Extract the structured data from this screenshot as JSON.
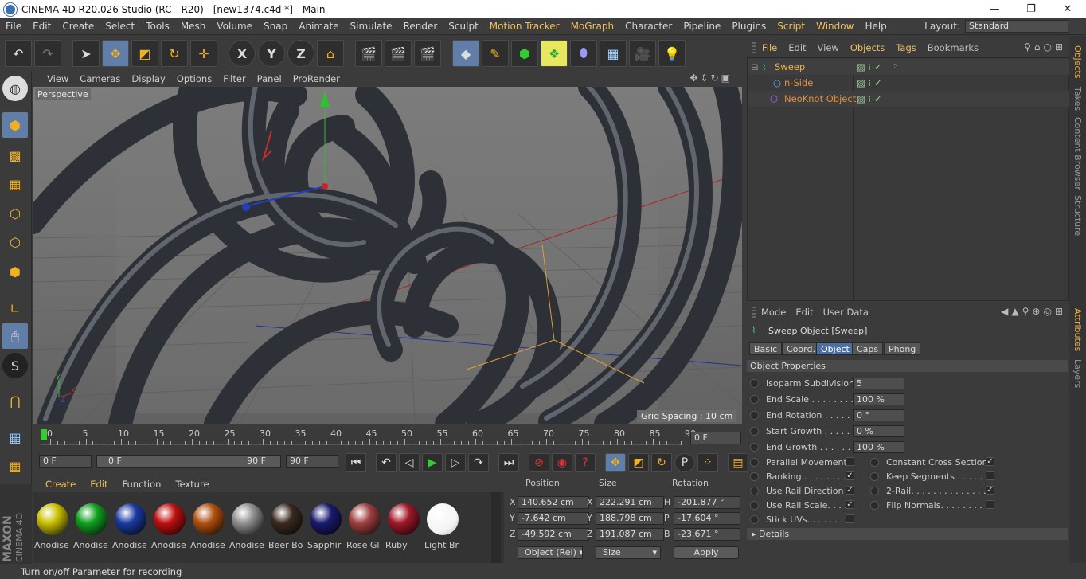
{
  "title": "CINEMA 4D R20.026 Studio (RC - R20) - [new1374.c4d *] - Main",
  "window_controls": {
    "minimize": "—",
    "maximize": "❐",
    "close": "✕"
  },
  "menu": [
    "File",
    "Edit",
    "Create",
    "Select",
    "Tools",
    "Mesh",
    "Volume",
    "Snap",
    "Animate",
    "Simulate",
    "Render",
    "Sculpt",
    "Motion Tracker",
    "MoGraph",
    "Character",
    "Pipeline",
    "Plugins",
    "Script",
    "Window",
    "Help"
  ],
  "layout": {
    "label": "Layout:",
    "value": "Standard"
  },
  "viewport": {
    "menu": [
      "View",
      "Cameras",
      "Display",
      "Options",
      "Filter",
      "Panel",
      "ProRender"
    ],
    "camera_label": "Perspective",
    "grid_spacing": "Grid Spacing : 10 cm"
  },
  "timeline": {
    "ticks": [
      "0",
      "5",
      "10",
      "15",
      "20",
      "25",
      "30",
      "35",
      "40",
      "45",
      "50",
      "55",
      "60",
      "65",
      "70",
      "75",
      "80",
      "85",
      "90"
    ],
    "current_frame": "0 F",
    "start": "0 F",
    "range_start": "0 F",
    "range_end": "90 F",
    "end": "90 F"
  },
  "materials": {
    "menu": [
      "Create",
      "Edit",
      "Function",
      "Texture"
    ],
    "items": [
      {
        "label": "Anodise",
        "color": "#c8c000"
      },
      {
        "label": "Anodise",
        "color": "#10a020"
      },
      {
        "label": "Anodise",
        "color": "#1a3aa0"
      },
      {
        "label": "Anodise",
        "color": "#c01010"
      },
      {
        "label": "Anodise",
        "color": "#b05010"
      },
      {
        "label": "Anodise",
        "color": "#909090"
      },
      {
        "label": "Beer Bo",
        "color": "#3a2a20"
      },
      {
        "label": "Sapphir",
        "color": "#1a1a70"
      },
      {
        "label": "Rose Gl",
        "color": "#a04040"
      },
      {
        "label": "Ruby",
        "color": "#a01828"
      },
      {
        "label": "Light Br",
        "color": "#f4f4f4"
      }
    ]
  },
  "coordinates": {
    "headers": {
      "position": "Position",
      "size": "Size",
      "rotation": "Rotation"
    },
    "rows": [
      {
        "axis": "X",
        "pos": "140.652 cm",
        "size_axis": "X",
        "size": "222.291 cm",
        "rot_axis": "H",
        "rot": "-201.877 °"
      },
      {
        "axis": "Y",
        "pos": "-7.642 cm",
        "size_axis": "Y",
        "size": "188.798 cm",
        "rot_axis": "P",
        "rot": "-17.604 °"
      },
      {
        "axis": "Z",
        "pos": "-49.592 cm",
        "size_axis": "Z",
        "size": "191.087 cm",
        "rot_axis": "B",
        "rot": "-23.671 °"
      }
    ],
    "mode": "Object (Rel)",
    "size_mode": "Size",
    "apply": "Apply"
  },
  "status": "Turn on/off Parameter for recording",
  "object_manager": {
    "menu": [
      "File",
      "Edit",
      "View",
      "Objects",
      "Tags",
      "Bookmarks"
    ],
    "objects": [
      {
        "name": "Sweep",
        "indent": 0
      },
      {
        "name": "n-Side",
        "indent": 1
      },
      {
        "name": "NeoKnot Object",
        "indent": 1
      }
    ],
    "side_tabs": [
      "Objects",
      "Takes",
      "Content Browser",
      "Structure"
    ]
  },
  "attributes": {
    "menu": [
      "Mode",
      "Edit",
      "User Data"
    ],
    "object_title": "Sweep Object [Sweep]",
    "tabs": [
      "Basic",
      "Coord.",
      "Object",
      "Caps",
      "Phong"
    ],
    "active_tab": "Object",
    "section": "Object Properties",
    "fields": [
      {
        "label": "Isoparm Subdivision",
        "value": "5"
      },
      {
        "label": "End Scale . . . . . . . . . .",
        "value": "100 %"
      },
      {
        "label": "End Rotation . . . . . . .",
        "value": "0 °"
      },
      {
        "label": "Start Growth . . . . . . .",
        "value": "0 %"
      },
      {
        "label": "End Growth . . . . . . . .",
        "value": "100 %"
      }
    ],
    "checks_left": [
      {
        "label": "Parallel Movement",
        "checked": false
      },
      {
        "label": "Banking . . . . . . . . .",
        "checked": true
      },
      {
        "label": "Use Rail Direction",
        "checked": true
      },
      {
        "label": "Use Rail Scale. . . .",
        "checked": true
      },
      {
        "label": "Stick UVs. . . . . . . .",
        "checked": false
      }
    ],
    "checks_right": [
      {
        "label": "Constant Cross Section",
        "checked": true
      },
      {
        "label": "Keep Segments . . . . . . .",
        "checked": false
      },
      {
        "label": "2-Rail. . . . . . . . . . . . . . .",
        "checked": true
      },
      {
        "label": "Flip Normals. . . . . . . . .",
        "checked": false
      }
    ],
    "details": "Details",
    "side_tabs": [
      "Attributes",
      "Layers"
    ]
  }
}
